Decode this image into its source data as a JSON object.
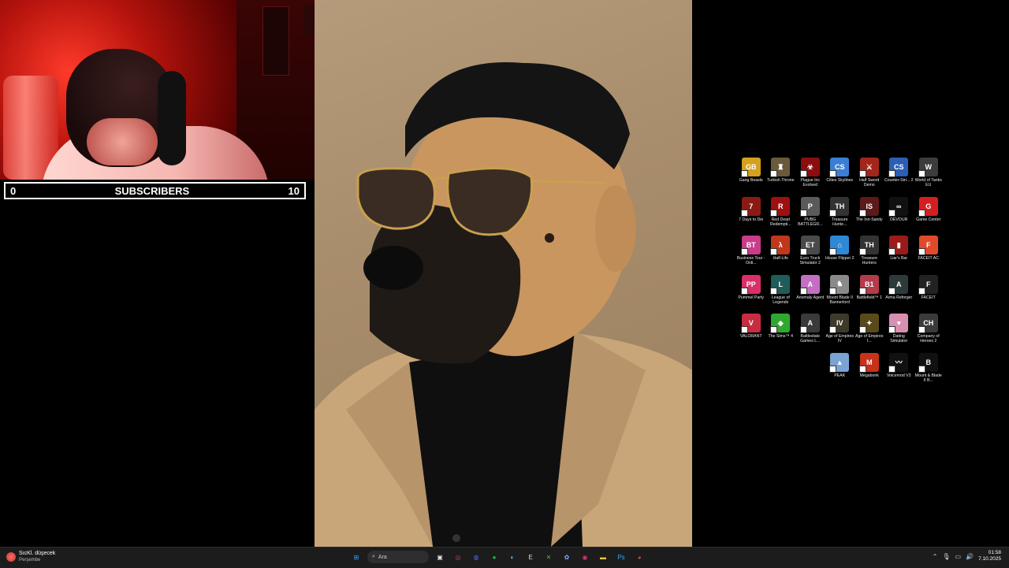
{
  "overlay": {
    "left_count": "0",
    "title": "SUBSCRIBERS",
    "right_count": "10"
  },
  "desktop_icons": [
    [
      {
        "label": "Gang Beasts",
        "color": "#d4a11e",
        "glyph": "GB",
        "icon": "gang-beasts-icon"
      },
      {
        "label": "Turkish Throne",
        "color": "#6b5a3a",
        "glyph": "♜",
        "icon": "turkish-throne-icon"
      },
      {
        "label": "Plague Inc Evolved",
        "color": "#8b0d0d",
        "glyph": "☣",
        "icon": "plague-inc-icon"
      },
      {
        "label": "Cities Skylines",
        "color": "#3b7fd4",
        "glyph": "CS",
        "icon": "cities-skylines-icon"
      },
      {
        "label": "Half Sword Demo",
        "color": "#a3261b",
        "glyph": "⚔",
        "icon": "half-sword-icon"
      },
      {
        "label": "Counter-Stri... 2",
        "color": "#2b5eb5",
        "glyph": "CS",
        "icon": "counter-strike-icon"
      },
      {
        "label": "World of Tanks EU",
        "color": "#3c3c3c",
        "glyph": "W",
        "icon": "world-of-tanks-icon"
      }
    ],
    [
      {
        "label": "7 Days to Die",
        "color": "#8a1b14",
        "glyph": "7",
        "icon": "seven-days-icon"
      },
      {
        "label": "Red Dead Redempti...",
        "color": "#9e1010",
        "glyph": "R",
        "icon": "red-dead-icon"
      },
      {
        "label": "PUBG BATTLEGR...",
        "color": "#5a5a5a",
        "glyph": "P",
        "icon": "pubg-icon"
      },
      {
        "label": "Treasure Hunte...",
        "color": "#333",
        "glyph": "TH",
        "icon": "treasure-hunter-icon"
      },
      {
        "label": "The Inn-Sanity",
        "color": "#5c1a1a",
        "glyph": "IS",
        "icon": "inn-sanity-icon"
      },
      {
        "label": "DEVOUR",
        "color": "#111",
        "glyph": "∞",
        "icon": "devour-icon"
      },
      {
        "label": "Game Center",
        "color": "#d41f1f",
        "glyph": "G",
        "icon": "game-center-icon"
      }
    ],
    [
      {
        "label": "Business Tour - Onli...",
        "color": "#c93c8a",
        "glyph": "BT",
        "icon": "business-tour-icon"
      },
      {
        "label": "Half-Life",
        "color": "#c0371a",
        "glyph": "λ",
        "icon": "half-life-icon"
      },
      {
        "label": "Euro Truck Simulator 2",
        "color": "#4a4a4a",
        "glyph": "ET",
        "icon": "euro-truck-icon"
      },
      {
        "label": "House Flipper 2",
        "color": "#2f88d6",
        "glyph": "⌂",
        "icon": "house-flipper-icon"
      },
      {
        "label": "Treasure Hunters",
        "color": "#333",
        "glyph": "TH",
        "icon": "treasure-hunters-icon"
      },
      {
        "label": "Liar's Bar",
        "color": "#9b1b1b",
        "glyph": "▮",
        "icon": "liars-bar-icon"
      },
      {
        "label": "FACEIT AC",
        "color": "#e04a2a",
        "glyph": "F",
        "icon": "faceit-ac-icon"
      }
    ],
    [
      {
        "label": "Pummel Party",
        "color": "#d92f6a",
        "glyph": "PP",
        "icon": "pummel-party-icon"
      },
      {
        "label": "League of Legends",
        "color": "#1f5c5a",
        "glyph": "L",
        "icon": "league-icon"
      },
      {
        "label": "Anomaly Agent",
        "color": "#c46ec4",
        "glyph": "A",
        "icon": "anomaly-agent-icon"
      },
      {
        "label": "Mount  Blade II Bannerlord",
        "color": "#8a8a8a",
        "glyph": "♞",
        "icon": "bannerlord-icon"
      },
      {
        "label": "Battlefield™ 1",
        "color": "#b33b4a",
        "glyph": "B1",
        "icon": "battlefield-icon"
      },
      {
        "label": "Arma Reforger",
        "color": "#2e3a3a",
        "glyph": "A",
        "icon": "arma-reforger-icon"
      },
      {
        "label": "FACEIT",
        "color": "#222",
        "glyph": "F",
        "icon": "faceit-icon"
      }
    ],
    [
      {
        "label": "VALORANT",
        "color": "#c72c41",
        "glyph": "V",
        "icon": "valorant-icon"
      },
      {
        "label": "The Sims™ 4",
        "color": "#2fa82f",
        "glyph": "◆",
        "icon": "sims-icon"
      },
      {
        "label": "Battlestate Games L...",
        "color": "#3a3a3a",
        "glyph": "A",
        "icon": "battlestate-icon"
      },
      {
        "label": "Age of Empires IV",
        "color": "#3e3a2a",
        "glyph": "IV",
        "icon": "age-of-empires-iv-icon"
      },
      {
        "label": "Age of Empires I...",
        "color": "#5a4a1a",
        "glyph": "✦",
        "icon": "age-of-empires-icon"
      },
      {
        "label": "Dating Simulator",
        "color": "#d98fb0",
        "glyph": "♥",
        "icon": "dating-simulator-icon"
      },
      {
        "label": "Company of Heroes 2",
        "color": "#3a3a3a",
        "glyph": "CH",
        "icon": "company-of-heroes-icon"
      }
    ],
    [
      {
        "label": "",
        "color": "transparent",
        "glyph": "",
        "icon": "empty"
      },
      {
        "label": "",
        "color": "transparent",
        "glyph": "",
        "icon": "empty"
      },
      {
        "label": "",
        "color": "transparent",
        "glyph": "",
        "icon": "empty"
      },
      {
        "label": "PEAK",
        "color": "#7aa3d6",
        "glyph": "▲",
        "icon": "peak-icon"
      },
      {
        "label": "Megabonk",
        "color": "#c7321a",
        "glyph": "M",
        "icon": "megabonk-icon"
      },
      {
        "label": "Voicemod V3",
        "color": "#111",
        "glyph": "〰",
        "icon": "voicemod-icon"
      },
      {
        "label": "Mount & Blade II B...",
        "color": "#111",
        "glyph": "B",
        "icon": "mount-blade-icon"
      }
    ]
  ],
  "taskbar": {
    "weather_title": "SıcKl. düşecek",
    "weather_sub": "Perşembe",
    "search_placeholder": "Ara",
    "time": "01:58",
    "date": "7.10.2025",
    "apps": [
      {
        "icon": "start-icon",
        "glyph": "⊞",
        "color": "#3aa0ff"
      },
      {
        "icon": "task-view-icon",
        "glyph": "▣",
        "color": "#ddd"
      },
      {
        "icon": "obs-icon",
        "glyph": "◎",
        "color": "#c43a8a"
      },
      {
        "icon": "discord-icon",
        "glyph": "◍",
        "color": "#5865f2"
      },
      {
        "icon": "spotify-icon",
        "glyph": "●",
        "color": "#1db954"
      },
      {
        "icon": "steam-icon",
        "glyph": "◐",
        "color": "#66c0f4"
      },
      {
        "icon": "epic-games-icon",
        "glyph": "E",
        "color": "#ddd"
      },
      {
        "icon": "xbox-icon",
        "glyph": "✕",
        "color": "#52b043"
      },
      {
        "icon": "copilot-icon",
        "glyph": "✿",
        "color": "#7fb0ff"
      },
      {
        "icon": "instagram-icon",
        "glyph": "◉",
        "color": "#e1306c"
      },
      {
        "icon": "file-explorer-icon",
        "glyph": "▬",
        "color": "#f5c242"
      },
      {
        "icon": "photoshop-icon",
        "glyph": "Ps",
        "color": "#31a8ff"
      },
      {
        "icon": "chrome-icon",
        "glyph": "◕",
        "color": "#e04a3a"
      }
    ]
  }
}
